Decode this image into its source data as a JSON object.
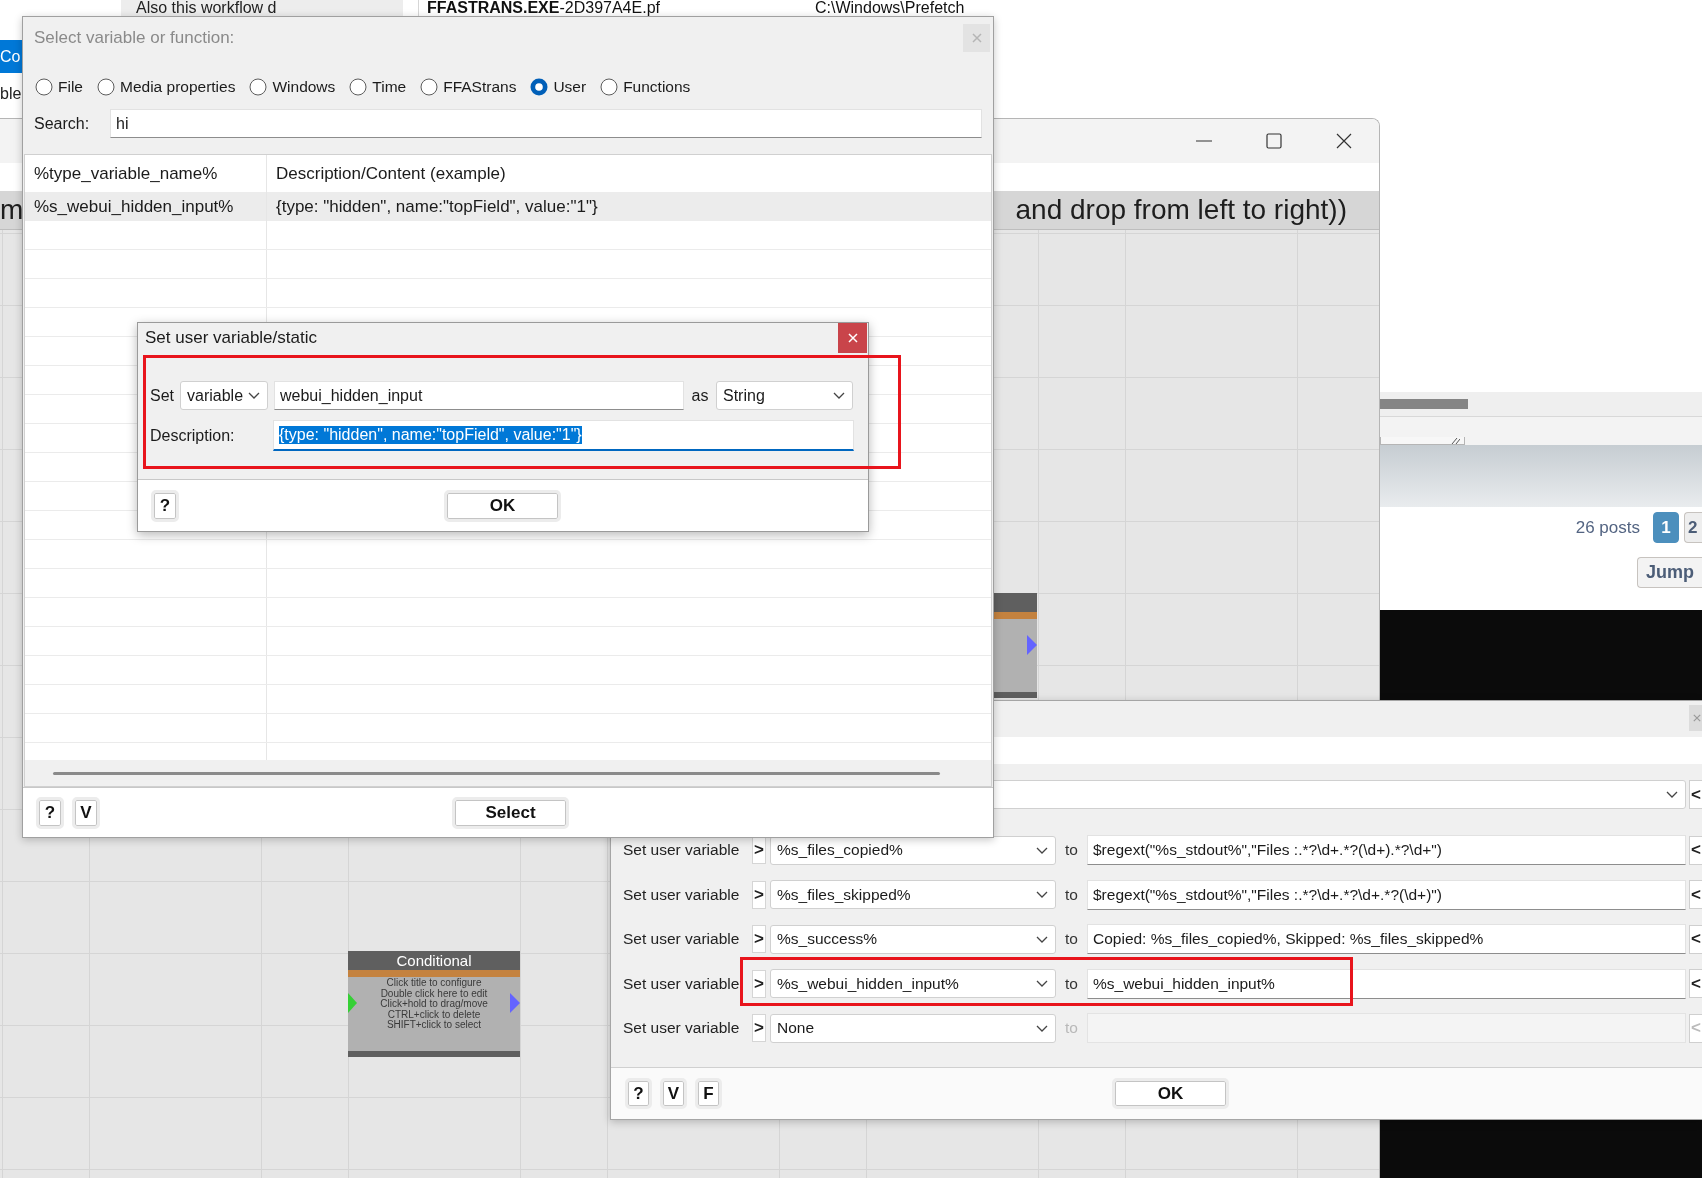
{
  "background_window": {
    "list_items": [
      {
        "label": "Co",
        "selected": true
      },
      {
        "label": "ble",
        "selected": false
      }
    ],
    "file_row": {
      "note": "Also this workflow d",
      "file_name": "**FFASTRANS.EXE**-2D397A4E.pf",
      "folder": "C:\\Windows\\Prefetch"
    }
  },
  "forum_page": {
    "post_count": "26 posts",
    "pages": [
      {
        "label": "1",
        "selected": true
      },
      {
        "label": "2",
        "selected": false
      }
    ],
    "jump_button": "Jump"
  },
  "workflow_window": {
    "banner": [
      "m",
      "and drop from left to right))"
    ],
    "conditional_node": {
      "title": "Conditional",
      "hints": [
        "Click title to configure",
        "Double click here to edit",
        "Click+hold to drag/move",
        "CTRL+click to delete",
        "SHIFT+click to select"
      ]
    }
  },
  "variables_dialog": {
    "side_button": "<",
    "rows": [
      {
        "label": "Set user variable",
        "arrow": ">",
        "variable": "%s_files_copied%",
        "to": "to",
        "value": "$regext(\"%s_stdout%\",\"Files :.*?\\d+.*?(\\d+).*?\\d+\")",
        "side_button": "<",
        "disabled": false,
        "annotated": false
      },
      {
        "label": "Set user variable",
        "arrow": ">",
        "variable": "%s_files_skipped%",
        "to": "to",
        "value": "$regext(\"%s_stdout%\",\"Files :.*?\\d+.*?\\d+.*?(\\d+)\")",
        "side_button": "<",
        "disabled": false,
        "annotated": false
      },
      {
        "label": "Set user variable",
        "arrow": ">",
        "variable": "%s_success%",
        "to": "to",
        "value": "Copied: %s_files_copied%, Skipped: %s_files_skipped%",
        "side_button": "<",
        "disabled": false,
        "annotated": false
      },
      {
        "label": "Set user variable",
        "arrow": ">",
        "variable": "%s_webui_hidden_input%",
        "to": "to",
        "value": "%s_webui_hidden_input%",
        "side_button": "<",
        "disabled": false,
        "annotated": true
      },
      {
        "label": "Set user variable",
        "arrow": ">",
        "variable": "None",
        "to": "to",
        "side_button": "<",
        "disabled": true,
        "annotated": false
      }
    ],
    "tool_buttons": [
      "?",
      "V",
      "F"
    ],
    "ok_button": "OK"
  },
  "select_dialog": {
    "title": "Select variable or function:",
    "categories": [
      {
        "label": "File",
        "selected": false
      },
      {
        "label": "Media properties",
        "selected": false
      },
      {
        "label": "Windows",
        "selected": false
      },
      {
        "label": "Time",
        "selected": false
      },
      {
        "label": "FFAStrans",
        "selected": false
      },
      {
        "label": "User",
        "selected": true
      },
      {
        "label": "Functions",
        "selected": false
      }
    ],
    "search": {
      "label": "Search:",
      "value": "hi"
    },
    "columns": [
      "%type_variable_name%",
      "Description/Content (example)"
    ],
    "rows": [
      {
        "cells": [
          "%s_webui_hidden_input%",
          "{type: \"hidden\", name:\"topField\", value:\"1\"}"
        ],
        "selected": true
      }
    ],
    "tool_buttons": [
      "?",
      "V"
    ],
    "select_button": "Select"
  },
  "set_variable_dialog": {
    "title": "Set user variable/static",
    "set_label": "Set",
    "scope": "variable",
    "name": "webui_hidden_input",
    "as_label": "as",
    "type": "String",
    "description_label": "Description:",
    "description": {
      "value": "{type: \"hidden\", name:\"topField\", value:\"1\"}",
      "highlighted": true
    },
    "annotated": true,
    "help_button": "?",
    "ok_button": "OK"
  }
}
